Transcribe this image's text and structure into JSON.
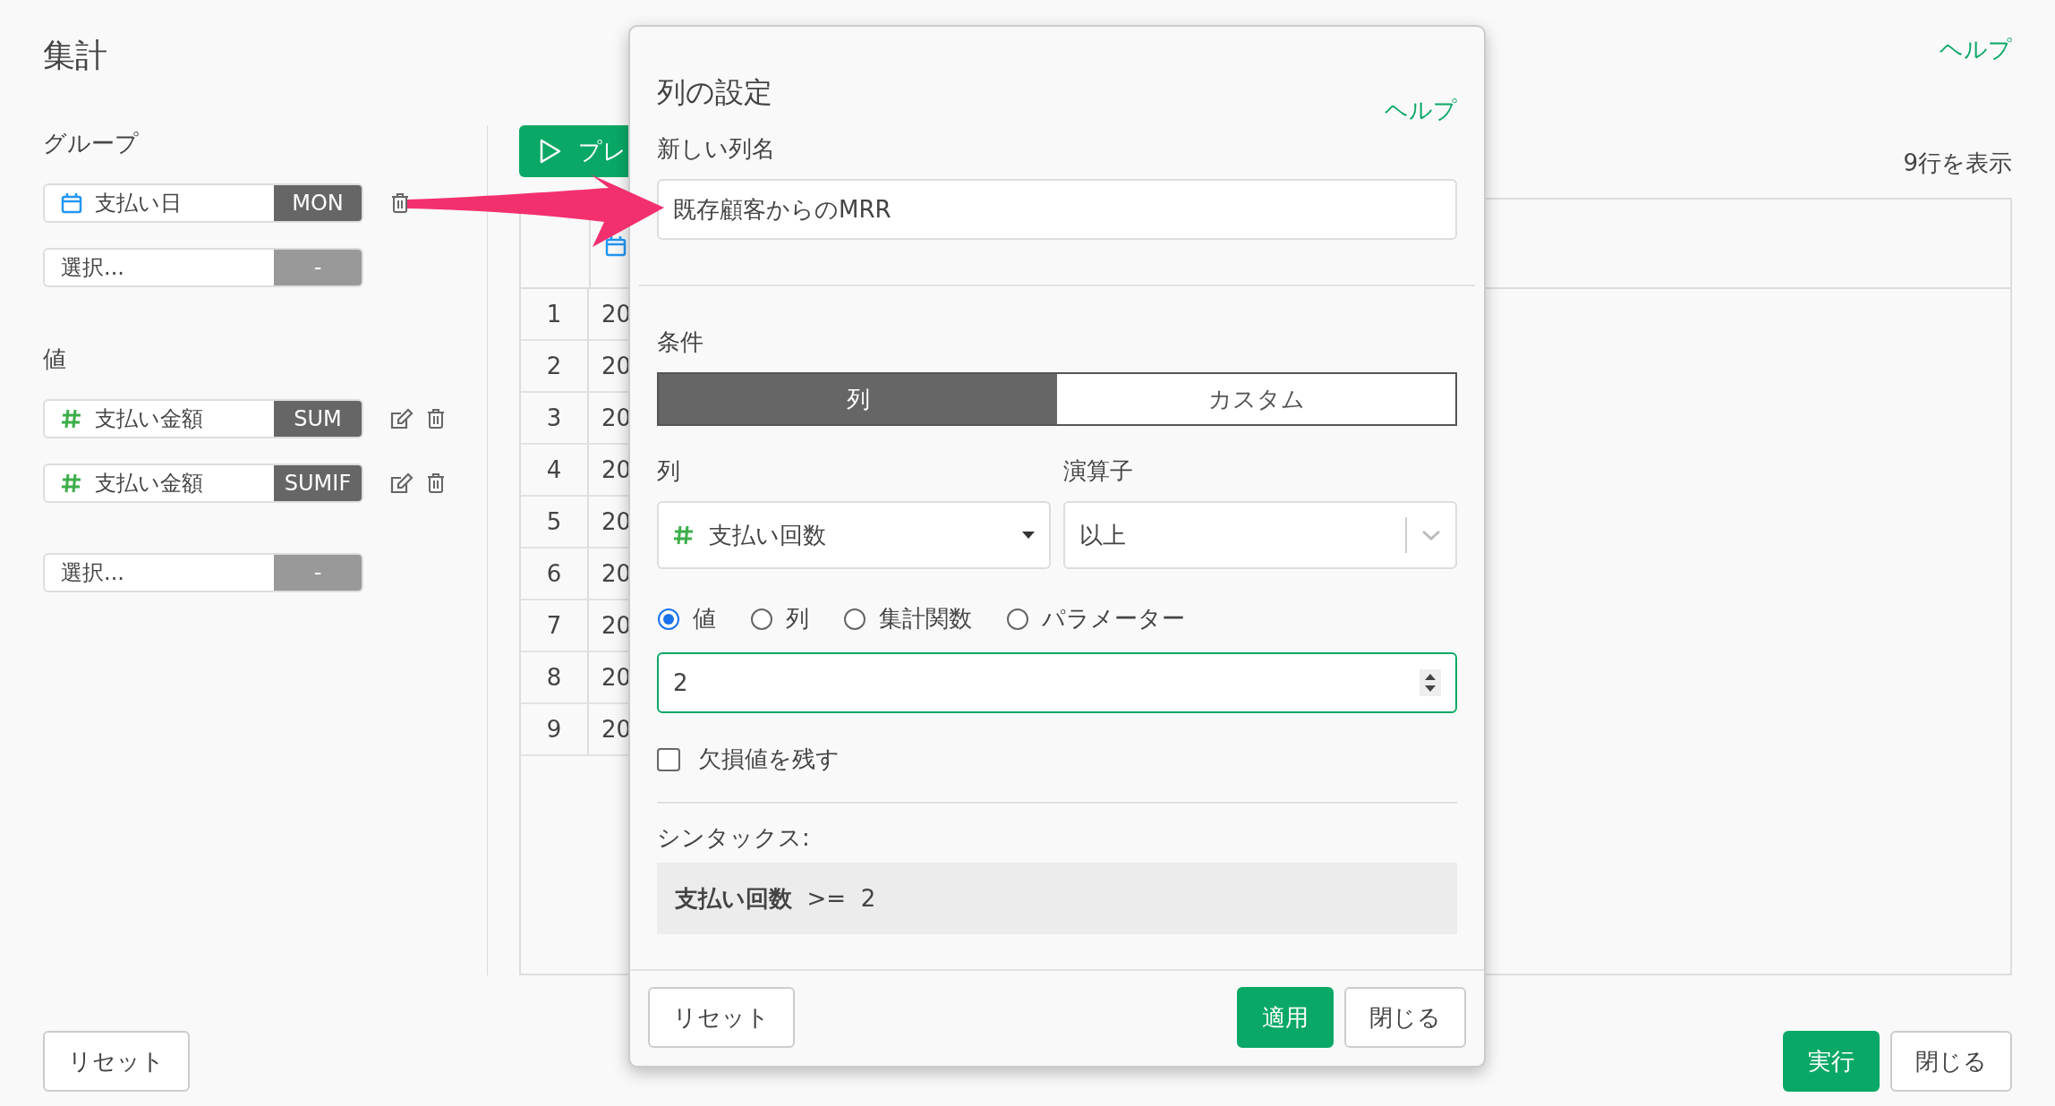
{
  "page": {
    "title": "集計",
    "help": "ヘルプ"
  },
  "sections": [
    {
      "label": "グループ",
      "items": [
        {
          "kind": "date",
          "name": "支払い日",
          "function": "MON",
          "editable": false
        }
      ],
      "picker": {
        "placeholder": "選択...",
        "function": "-"
      }
    },
    {
      "label": "値",
      "items": [
        {
          "kind": "number",
          "name": "支払い金額",
          "function": "SUM",
          "editable": true
        },
        {
          "kind": "number",
          "name": "支払い金額",
          "function": "SUMIF",
          "editable": true
        }
      ],
      "picker": {
        "placeholder": "選択...",
        "function": "-"
      }
    }
  ],
  "preview_button": {
    "label": "プレ"
  },
  "row_count": "9行を表示",
  "table": {
    "rows": [
      {
        "index": "1",
        "column_2": "20"
      },
      {
        "index": "2",
        "column_2": "20"
      },
      {
        "index": "3",
        "column_2": "20"
      },
      {
        "index": "4",
        "column_2": "20"
      },
      {
        "index": "5",
        "column_2": "20"
      },
      {
        "index": "6",
        "column_2": "20"
      },
      {
        "index": "7",
        "column_2": "20"
      },
      {
        "index": "8",
        "column_2": "20"
      },
      {
        "index": "9",
        "column_2": "20"
      }
    ]
  },
  "footer": {
    "left": [
      {
        "label": "リセット",
        "kind": "default"
      }
    ],
    "right": [
      {
        "label": "実行",
        "kind": "primary"
      },
      {
        "label": "閉じる",
        "kind": "default"
      }
    ]
  },
  "dialog": {
    "title": "列の設定",
    "help": "ヘルプ",
    "name_label": "新しい列名",
    "name_value": "既存顧客からのMRR",
    "condition_label": "条件",
    "tabs": [
      {
        "label": "列",
        "selected": true
      },
      {
        "label": "カスタム",
        "selected": false
      }
    ],
    "column_label": "列",
    "column_select": {
      "kind": "number",
      "value": "支払い回数"
    },
    "operator_label": "演算子",
    "operator_value": "以上",
    "sources": [
      {
        "label": "値",
        "selected": true
      },
      {
        "label": "列",
        "selected": false
      },
      {
        "label": "集計関数",
        "selected": false
      },
      {
        "label": "パラメーター",
        "selected": false
      }
    ],
    "value": "2",
    "keep_missing": {
      "label": "欠損値を残す",
      "checked": false
    },
    "syntax_label": "シンタックス:",
    "syntax": "**支払い回数**  >=  2",
    "footer": {
      "left": [
        {
          "label": "リセット",
          "kind": "default"
        }
      ],
      "right": [
        {
          "label": "適用",
          "kind": "primary"
        },
        {
          "label": "閉じる",
          "kind": "default"
        }
      ]
    }
  }
}
